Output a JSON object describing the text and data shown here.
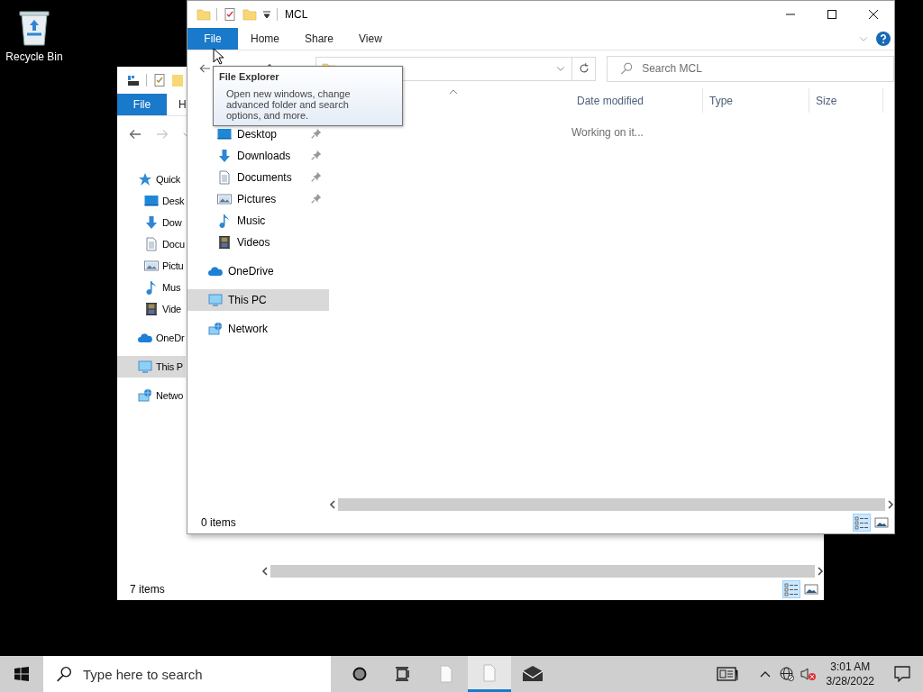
{
  "desktop": {
    "icons": [
      {
        "label": "Recycle Bin"
      }
    ]
  },
  "back_window": {
    "ribbon_tabs": [
      {
        "label": "File",
        "selected": true
      },
      {
        "label": "H",
        "selected": false
      }
    ],
    "nav_items": [
      {
        "label": "Quick",
        "kind": "star",
        "selected": false
      },
      {
        "label": "Desk",
        "kind": "desktop",
        "selected": false
      },
      {
        "label": "Dow",
        "kind": "download",
        "selected": false
      },
      {
        "label": "Docu",
        "kind": "document",
        "selected": false
      },
      {
        "label": "Pictu",
        "kind": "image",
        "selected": false
      },
      {
        "label": "Mus",
        "kind": "music",
        "selected": false
      },
      {
        "label": "Vide",
        "kind": "video",
        "selected": false
      },
      {
        "label": "OneDr",
        "kind": "cloud",
        "selected": false
      },
      {
        "label": "This P",
        "kind": "pc",
        "selected": true
      },
      {
        "label": "Netwo",
        "kind": "network",
        "selected": false
      }
    ],
    "status": "7 items",
    "view_buttons": [
      {
        "kind": "details",
        "selected": true
      },
      {
        "kind": "preview",
        "selected": false
      }
    ]
  },
  "front_window": {
    "title": "MCL",
    "ribbon_tabs": [
      {
        "label": "File",
        "selected": true
      },
      {
        "label": "Home",
        "selected": false
      },
      {
        "label": "Share",
        "selected": false
      },
      {
        "label": "View",
        "selected": false
      }
    ],
    "search": {
      "placeholder": "Search MCL"
    },
    "nav_items": [
      {
        "label": "Desktop",
        "kind": "desktop",
        "pinned": true,
        "selected": false
      },
      {
        "label": "Downloads",
        "kind": "download",
        "pinned": true,
        "selected": false
      },
      {
        "label": "Documents",
        "kind": "document",
        "pinned": true,
        "selected": false
      },
      {
        "label": "Pictures",
        "kind": "image",
        "pinned": true,
        "selected": false
      },
      {
        "label": "Music",
        "kind": "music",
        "pinned": false,
        "selected": false
      },
      {
        "label": "Videos",
        "kind": "video",
        "pinned": false,
        "selected": false
      },
      {
        "label": "OneDrive",
        "kind": "cloud",
        "pinned": false,
        "selected": false
      },
      {
        "label": "This PC",
        "kind": "pc",
        "pinned": false,
        "selected": true
      },
      {
        "label": "Network",
        "kind": "network",
        "pinned": false,
        "selected": false
      }
    ],
    "columns": [
      "Date modified",
      "Type",
      "Size"
    ],
    "message": "Working on it...",
    "status": "0 items",
    "view_buttons": [
      {
        "kind": "details",
        "selected": true
      },
      {
        "kind": "preview",
        "selected": false
      }
    ]
  },
  "tooltip": {
    "title": "File Explorer",
    "text": "Open new windows, change advanced folder and search options, and more."
  },
  "taskbar": {
    "search": {
      "placeholder": "Type here to search"
    },
    "apps": [
      {
        "kind": "document",
        "selected": false
      },
      {
        "kind": "document",
        "selected": true
      },
      {
        "kind": "mail",
        "selected": false
      }
    ],
    "time": "3:01 AM",
    "date": "3/28/2022"
  }
}
